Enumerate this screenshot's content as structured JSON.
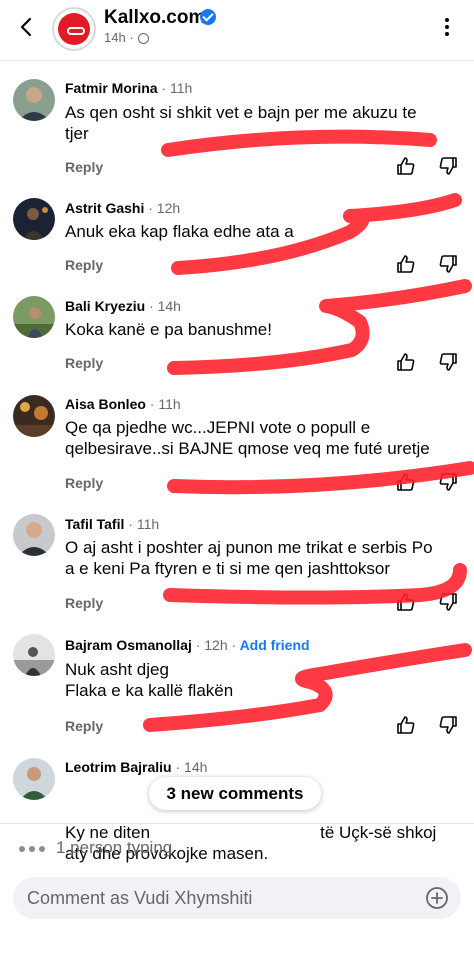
{
  "header": {
    "page_name": "Kallxo.com",
    "time": "14h"
  },
  "comments": [
    {
      "author": "Fatmir Morina",
      "time": "· 11h",
      "lines": [
        "As qen osht si shkit vet e bajn per me akuzu te",
        "tjer"
      ],
      "reply": "Reply"
    },
    {
      "author": "Astrit Gashi",
      "time": "· 12h",
      "lines": [
        "Anuk eka kap flaka edhe ata a"
      ],
      "reply": "Reply"
    },
    {
      "author": "Bali Kryeziu",
      "time": "· 14h",
      "lines": [
        "Koka kanë e pa banushme!"
      ],
      "reply": "Reply"
    },
    {
      "author": "Aisa Bonleo",
      "time": "· 11h",
      "lines": [
        "Qe qa pjedhe wc...JEPNI vote o popull e",
        "qelbesirave..si BAJNE qmose veq me futé uretje"
      ],
      "reply": "Reply"
    },
    {
      "author": "Tafil Tafil",
      "time": "· 11h",
      "lines": [
        "O aj asht i poshter aj punon me trikat e serbis Po",
        "a e keni Pa ftyren e ti si me qen jashttoksor"
      ],
      "reply": "Reply"
    },
    {
      "author": "Bajram Osmanollaj",
      "time": "· 12h ·",
      "add_friend": "Add friend",
      "lines": [
        "Nuk asht djeg",
        "Flaka e ka kallë flakën"
      ],
      "reply": "Reply"
    },
    {
      "author": "Leotrim Bajraliu",
      "time": "· 14h",
      "lines": [
        "Ky ne diten                                    të Uçk-së shkoj",
        "aty dhe provokojke masen."
      ]
    }
  ],
  "new_comments_pill": "3 new comments",
  "typing": "1 person typing",
  "composer_placeholder": "Comment as Vudi Xhymshiti",
  "colors": {
    "accent": "#1877f2",
    "brand": "#e01b24",
    "scribble": "#ff1f2a"
  }
}
